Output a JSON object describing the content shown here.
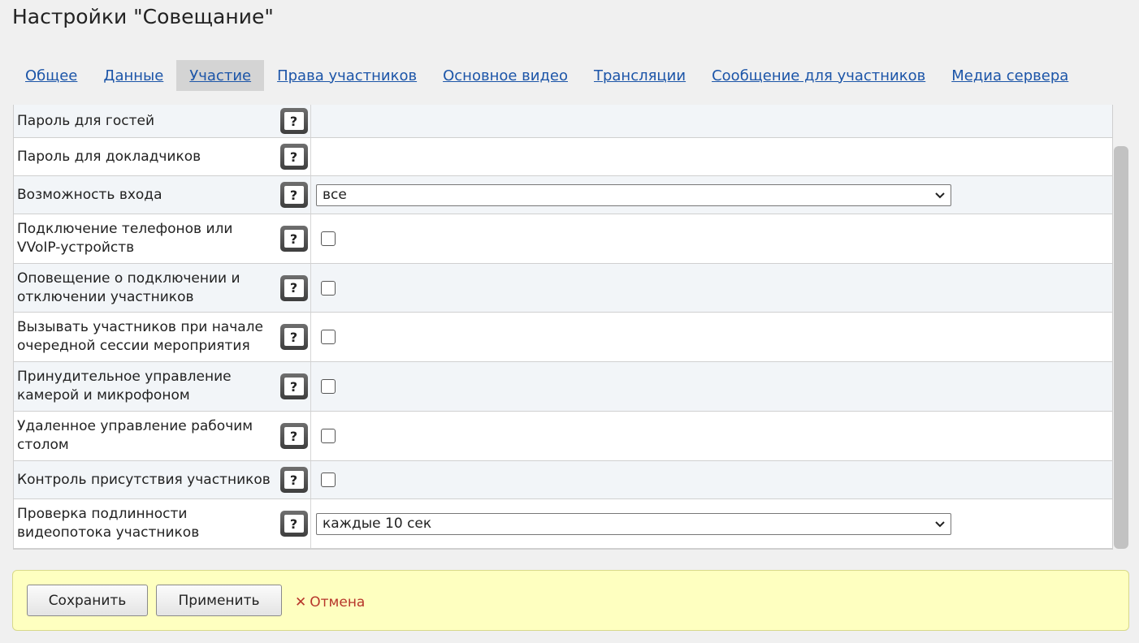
{
  "title": "Настройки \"Совещание\"",
  "tabs": [
    {
      "label": "Общее",
      "active": false
    },
    {
      "label": "Данные",
      "active": false
    },
    {
      "label": "Участие",
      "active": true
    },
    {
      "label": "Права участников",
      "active": false
    },
    {
      "label": "Основное видео",
      "active": false
    },
    {
      "label": "Трансляции",
      "active": false
    },
    {
      "label": "Сообщение для участников",
      "active": false
    },
    {
      "label": "Медиа сервера",
      "active": false
    }
  ],
  "settings": [
    {
      "label": "Пароль для гостей",
      "control": "none"
    },
    {
      "label": "Пароль для докладчиков",
      "control": "none"
    },
    {
      "label": "Возможность входа",
      "control": "select",
      "value": "все"
    },
    {
      "label": "Подключение телефонов или VVoIP-устройств",
      "control": "checkbox",
      "checked": false
    },
    {
      "label": "Оповещение о подключении и отключении участников",
      "control": "checkbox",
      "checked": false
    },
    {
      "label": "Вызывать участников при начале очередной сессии мероприятия",
      "control": "checkbox",
      "checked": false
    },
    {
      "label": "Принудительное управление камерой и микрофоном",
      "control": "checkbox",
      "checked": false
    },
    {
      "label": "Удаленное управление рабочим столом",
      "control": "checkbox",
      "checked": false
    },
    {
      "label": "Контроль присутствия участников",
      "control": "checkbox",
      "checked": false
    },
    {
      "label": "Проверка подлинности видеопотока участников",
      "control": "select",
      "value": "каждые 10 сек"
    }
  ],
  "help_icon_glyph": "?",
  "actions": {
    "save_label": "Сохранить",
    "apply_label": "Применить",
    "cancel_label": "Отмена",
    "cancel_glyph": "✕"
  },
  "colors": {
    "link": "#1c55a8",
    "active_tab_bg": "#d4d4d4",
    "action_bar_bg": "#feffc0",
    "cancel": "#b7362b"
  }
}
